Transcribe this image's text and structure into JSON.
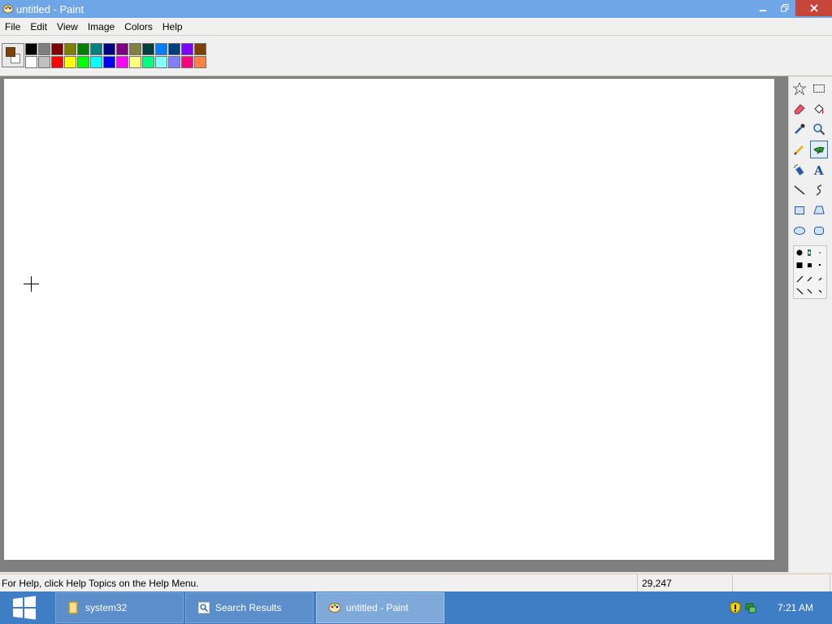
{
  "window": {
    "title": "untitled - Paint"
  },
  "menu": [
    "File",
    "Edit",
    "View",
    "Image",
    "Colors",
    "Help"
  ],
  "colors": {
    "foreground": "#804000",
    "background": "#ffffff",
    "palette_top": [
      "#000000",
      "#808080",
      "#800000",
      "#808000",
      "#008000",
      "#008080",
      "#000080",
      "#800080",
      "#808040",
      "#004040",
      "#0080ff",
      "#004080",
      "#8000ff",
      "#804000"
    ],
    "palette_bottom": [
      "#ffffff",
      "#c0c0c0",
      "#ff0000",
      "#ffff00",
      "#00ff00",
      "#00ffff",
      "#0000ff",
      "#ff00ff",
      "#ffff80",
      "#00ff80",
      "#80ffff",
      "#8080ff",
      "#ff0080",
      "#ff8040"
    ]
  },
  "tools": [
    {
      "name": "free-form-select",
      "icon": "star-select-icon"
    },
    {
      "name": "rect-select",
      "icon": "rect-select-icon"
    },
    {
      "name": "eraser",
      "icon": "eraser-icon"
    },
    {
      "name": "fill",
      "icon": "fill-bucket-icon"
    },
    {
      "name": "pick-color",
      "icon": "eyedropper-icon"
    },
    {
      "name": "magnifier",
      "icon": "magnifier-icon"
    },
    {
      "name": "pencil",
      "icon": "pencil-icon"
    },
    {
      "name": "brush",
      "icon": "brush-icon",
      "selected": true
    },
    {
      "name": "airbrush",
      "icon": "airbrush-icon"
    },
    {
      "name": "text",
      "icon": "text-icon"
    },
    {
      "name": "line",
      "icon": "line-icon"
    },
    {
      "name": "curve",
      "icon": "curve-icon"
    },
    {
      "name": "rectangle",
      "icon": "rectangle-icon"
    },
    {
      "name": "polygon",
      "icon": "polygon-icon"
    },
    {
      "name": "ellipse",
      "icon": "ellipse-icon"
    },
    {
      "name": "rounded-rectangle",
      "icon": "rounded-rectangle-icon"
    }
  ],
  "status": {
    "help": "For Help, click Help Topics on the Help Menu.",
    "coords": "29,247"
  },
  "taskbar": {
    "items": [
      {
        "label": "system32",
        "icon": "folder-icon"
      },
      {
        "label": "Search Results",
        "icon": "search-results-icon"
      },
      {
        "label": "untitled - Paint",
        "icon": "paint-icon",
        "active": true
      }
    ],
    "clock": "7:21 AM"
  }
}
